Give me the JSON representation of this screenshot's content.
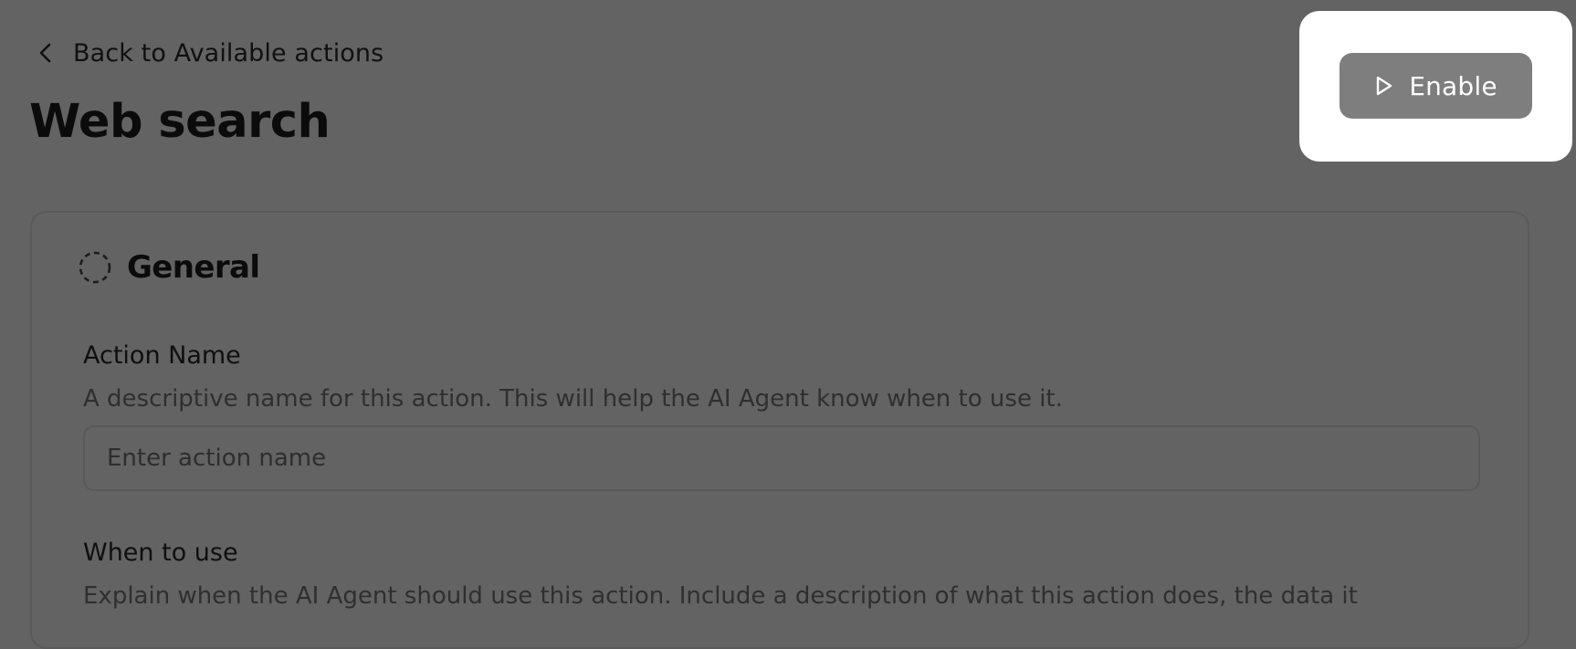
{
  "header": {
    "back_label": "Back to Available actions",
    "title": "Web search"
  },
  "toolbar": {
    "enable_label": "Enable"
  },
  "general": {
    "title": "General",
    "action_name": {
      "label": "Action Name",
      "help": "A descriptive name for this action. This will help the AI Agent know when to use it.",
      "placeholder": "Enter action name",
      "value": ""
    },
    "when_to_use": {
      "label": "When to use",
      "help": "Explain when the AI Agent should use this action. Include a description of what this action does, the data it"
    }
  },
  "icons": {
    "back": "chevron-left-icon",
    "status": "dashed-circle-icon",
    "enable": "play-icon"
  },
  "colors": {
    "overlay_background": "#636363",
    "spotlight": "#ffffff",
    "enable_button": "#7e7e7e",
    "enable_text": "#ffffff"
  }
}
